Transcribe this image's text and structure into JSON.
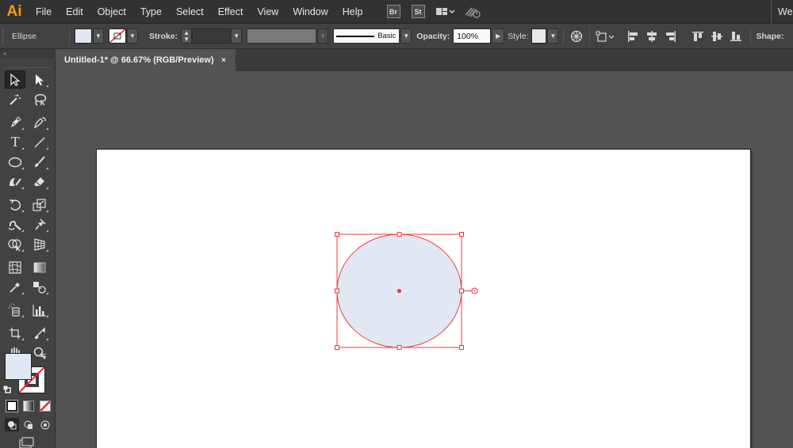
{
  "app": {
    "logo": "Ai",
    "menus": [
      "File",
      "Edit",
      "Object",
      "Type",
      "Select",
      "Effect",
      "View",
      "Window",
      "Help"
    ],
    "bridge_label": "Br",
    "stock_label": "St",
    "workspace_label": "We"
  },
  "control_bar": {
    "object_type": "Ellipse",
    "fill_color": "#e1e8f3",
    "stroke_label": "Stroke:",
    "stroke_weight": "",
    "profile_label": "Basic",
    "opacity_label": "Opacity:",
    "opacity_value": "100%",
    "style_label": "Style:",
    "shape_label": "Shape:"
  },
  "document": {
    "tab_title": "Untitled-1* @ 66.67% (RGB/Preview)",
    "close_glyph": "×",
    "selection_color": "#f0373c",
    "ellipse_fill": "#e1e8f3"
  },
  "tools": {
    "collapse_glyph": "«",
    "fill_color": "#e1e8f3"
  }
}
